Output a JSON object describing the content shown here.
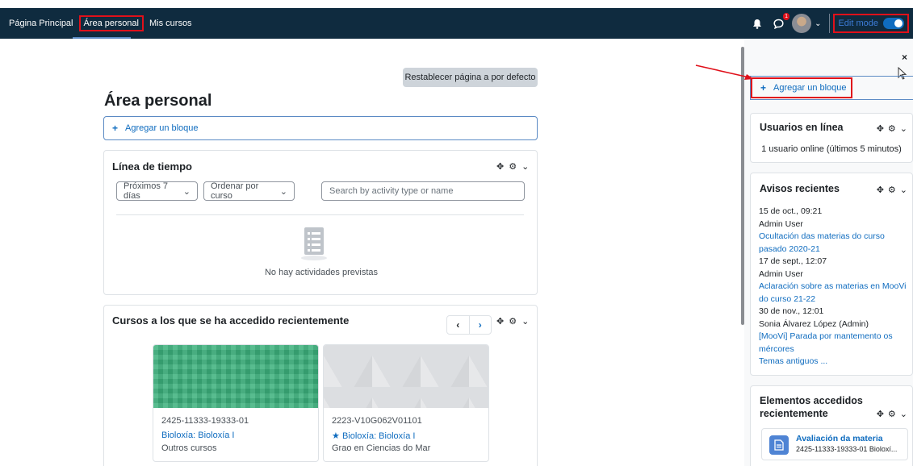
{
  "navbar": {
    "links": [
      "Página Principal",
      "Área personal",
      "Mis cursos"
    ],
    "message_badge": "1",
    "edit_mode_label": "Edit mode"
  },
  "main": {
    "reset_button": "Restablecer página a por defecto",
    "title": "Área personal",
    "add_block": "Agregar un bloque",
    "timeline": {
      "title": "Línea de tiempo",
      "filter_days": "Próximos 7 días",
      "sort": "Ordenar por curso",
      "search_placeholder": "Search by activity type or name",
      "empty": "No hay actividades previstas"
    },
    "recent_courses": {
      "title": "Cursos a los que se ha accedido recientemente",
      "courses": [
        {
          "code": "2425-11333-19333-01",
          "name": "Bioloxía: Bioloxía I",
          "category": "Outros cursos",
          "starred": false
        },
        {
          "code": "2223-V10G062V01101",
          "name": "Bioloxía: Bioloxía I",
          "category": "Grao en Ciencias do Mar",
          "starred": true
        }
      ]
    }
  },
  "drawer": {
    "close": "×",
    "add_block": "Agregar un bloque",
    "online_users": {
      "title": "Usuarios en línea",
      "text": "1 usuario online (últimos 5 minutos)"
    },
    "news": {
      "title": "Avisos recientes",
      "items": [
        {
          "date": "15 de oct., 09:21",
          "author": "Admin User",
          "link": "Ocultación das materias do curso pasado 2020-21"
        },
        {
          "date": "17 de sept., 12:07",
          "author": "Admin User",
          "link": "Aclaración sobre as materias en MooVi do curso 21-22"
        },
        {
          "date": "30 de nov., 12:01",
          "author": "Sonia Álvarez López (Admin)",
          "link": "[MooVi] Parada por mantemento os mércores"
        }
      ],
      "older": "Temas antiguos ..."
    },
    "recent_items": {
      "title": "Elementos accedidos recientemente",
      "item_title": "Avaliación da materia",
      "item_sub": "2425-11333-19333-01 Bioloxí..."
    }
  },
  "colors": {
    "navbar": "#0f2b3f",
    "link": "#0f6cbf",
    "highlight": "#e0101a"
  }
}
